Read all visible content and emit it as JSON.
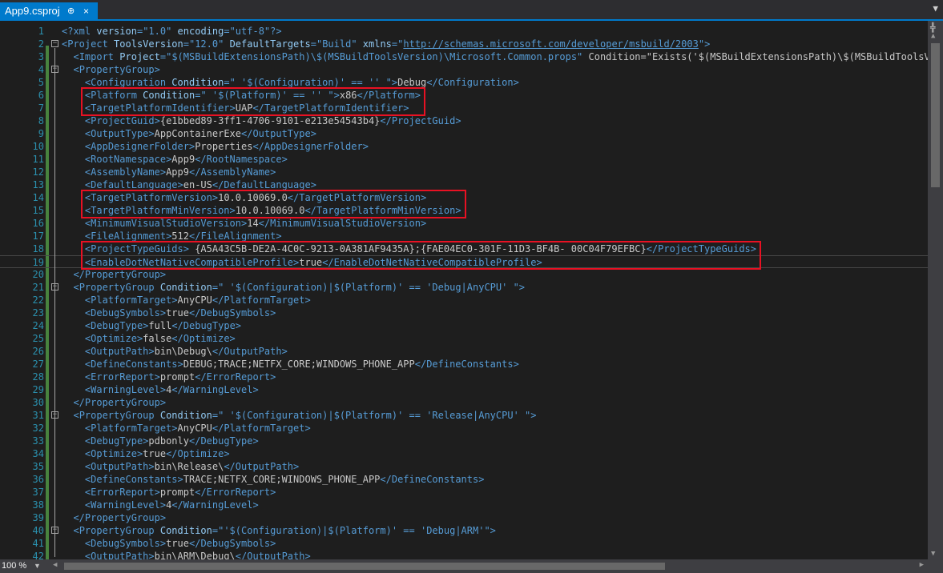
{
  "tab": {
    "title": "App9.csproj",
    "pin_glyph": "⊕",
    "close_glyph": "×"
  },
  "editor": {
    "lines": [
      {
        "n": "1",
        "code": "<?xml version=\"1.0\" encoding=\"utf-8\"?>"
      },
      {
        "n": "2",
        "code": "<Project ToolsVersion=\"12.0\" DefaultTargets=\"Build\" xmlns=\"http://schemas.microsoft.com/developer/msbuild/2003\">"
      },
      {
        "n": "3",
        "code": "  <Import Project=\"$(MSBuildExtensionsPath)\\$(MSBuildToolsVersion)\\Microsoft.Common.props\" Condition=\"Exists('$(MSBuildExtensionsPath)\\$(MSBuildToolsVer"
      },
      {
        "n": "4",
        "code": "  <PropertyGroup>"
      },
      {
        "n": "5",
        "code": "    <Configuration Condition=\" '$(Configuration)' == '' \">Debug</Configuration>"
      },
      {
        "n": "6",
        "code": "    <Platform Condition=\" '$(Platform)' == '' \">x86</Platform>"
      },
      {
        "n": "7",
        "code": "    <TargetPlatformIdentifier>UAP</TargetPlatformIdentifier>"
      },
      {
        "n": "8",
        "code": "    <ProjectGuid>{e1bbed89-3ff1-4706-9101-e213e54543b4}</ProjectGuid>"
      },
      {
        "n": "9",
        "code": "    <OutputType>AppContainerExe</OutputType>"
      },
      {
        "n": "10",
        "code": "    <AppDesignerFolder>Properties</AppDesignerFolder>"
      },
      {
        "n": "11",
        "code": "    <RootNamespace>App9</RootNamespace>"
      },
      {
        "n": "12",
        "code": "    <AssemblyName>App9</AssemblyName>"
      },
      {
        "n": "13",
        "code": "    <DefaultLanguage>en-US</DefaultLanguage>"
      },
      {
        "n": "14",
        "code": "    <TargetPlatformVersion>10.0.10069.0</TargetPlatformVersion>"
      },
      {
        "n": "15",
        "code": "    <TargetPlatformMinVersion>10.0.10069.0</TargetPlatformMinVersion>"
      },
      {
        "n": "16",
        "code": "    <MinimumVisualStudioVersion>14</MinimumVisualStudioVersion>"
      },
      {
        "n": "17",
        "code": "    <FileAlignment>512</FileAlignment>"
      },
      {
        "n": "18",
        "code": "    <ProjectTypeGuids> {A5A43C5B-DE2A-4C0C-9213-0A381AF9435A};{FAE04EC0-301F-11D3-BF4B- 00C04F79EFBC}</ProjectTypeGuids>"
      },
      {
        "n": "19",
        "code": "    <EnableDotNetNativeCompatibleProfile>true</EnableDotNetNativeCompatibleProfile>"
      },
      {
        "n": "20",
        "code": "  </PropertyGroup>"
      },
      {
        "n": "21",
        "code": "  <PropertyGroup Condition=\" '$(Configuration)|$(Platform)' == 'Debug|AnyCPU' \">"
      },
      {
        "n": "22",
        "code": "    <PlatformTarget>AnyCPU</PlatformTarget>"
      },
      {
        "n": "23",
        "code": "    <DebugSymbols>true</DebugSymbols>"
      },
      {
        "n": "24",
        "code": "    <DebugType>full</DebugType>"
      },
      {
        "n": "25",
        "code": "    <Optimize>false</Optimize>"
      },
      {
        "n": "26",
        "code": "    <OutputPath>bin\\Debug\\</OutputPath>"
      },
      {
        "n": "27",
        "code": "    <DefineConstants>DEBUG;TRACE;NETFX_CORE;WINDOWS_PHONE_APP</DefineConstants>"
      },
      {
        "n": "28",
        "code": "    <ErrorReport>prompt</ErrorReport>"
      },
      {
        "n": "29",
        "code": "    <WarningLevel>4</WarningLevel>"
      },
      {
        "n": "30",
        "code": "  </PropertyGroup>"
      },
      {
        "n": "31",
        "code": "  <PropertyGroup Condition=\" '$(Configuration)|$(Platform)' == 'Release|AnyCPU' \">"
      },
      {
        "n": "32",
        "code": "    <PlatformTarget>AnyCPU</PlatformTarget>"
      },
      {
        "n": "33",
        "code": "    <DebugType>pdbonly</DebugType>"
      },
      {
        "n": "34",
        "code": "    <Optimize>true</Optimize>"
      },
      {
        "n": "35",
        "code": "    <OutputPath>bin\\Release\\</OutputPath>"
      },
      {
        "n": "36",
        "code": "    <DefineConstants>TRACE;NETFX_CORE;WINDOWS_PHONE_APP</DefineConstants>"
      },
      {
        "n": "37",
        "code": "    <ErrorReport>prompt</ErrorReport>"
      },
      {
        "n": "38",
        "code": "    <WarningLevel>4</WarningLevel>"
      },
      {
        "n": "39",
        "code": "  </PropertyGroup>"
      },
      {
        "n": "40",
        "code": "  <PropertyGroup Condition=\"'$(Configuration)|$(Platform)' == 'Debug|ARM'\">"
      },
      {
        "n": "41",
        "code": "    <DebugSymbols>true</DebugSymbols>"
      },
      {
        "n": "42",
        "code": "    <OutputPath>bin\\ARM\\Debug\\</OutputPath>"
      }
    ],
    "current_line": "19",
    "highlighted_line_groups": [
      [
        "6",
        "7"
      ],
      [
        "14",
        "15"
      ],
      [
        "18",
        "19"
      ]
    ],
    "fold_markers": [
      "2",
      "4",
      "21",
      "31",
      "40"
    ]
  },
  "statusbar": {
    "zoom": "100 %"
  },
  "colors": {
    "accent": "#007acc",
    "highlight_box": "#e81123",
    "tag": "#569cd6",
    "attribute": "#92caf4",
    "value": "#c8c8c8",
    "line_number": "#2b91af",
    "change_bar": "#57a64a"
  }
}
